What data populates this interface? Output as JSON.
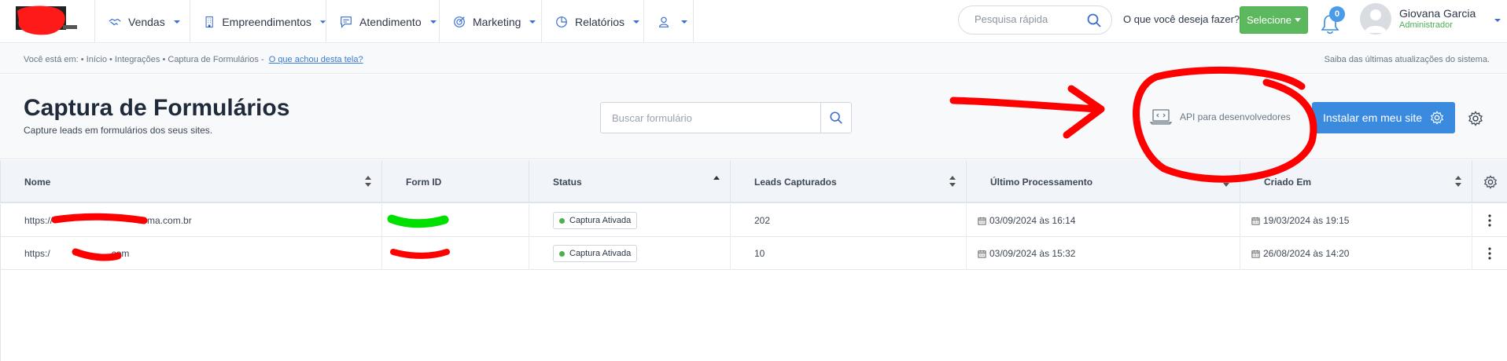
{
  "nav": {
    "items": [
      {
        "label": "Vendas",
        "icon": "handshake-icon"
      },
      {
        "label": "Empreendimentos",
        "icon": "building-icon"
      },
      {
        "label": "Atendimento",
        "icon": "chat-icon"
      },
      {
        "label": "Marketing",
        "icon": "target-icon"
      },
      {
        "label": "Relatórios",
        "icon": "pie-chart-icon"
      },
      {
        "label": "",
        "icon": "user-icon"
      }
    ],
    "search_placeholder": "Pesquisa rápida",
    "ask_label": "O que você deseja fazer?",
    "select_label": "Selecione",
    "notification_count": "0",
    "user": {
      "name": "Giovana Garcia",
      "role": "Administrador"
    }
  },
  "breadcrumb": {
    "text": "Você está em: • Início • Integrações • Captura de Formulários -",
    "feedback_link": "O que achou desta tela?",
    "updates": "Saiba das últimas atualizações do sistema."
  },
  "header": {
    "title": "Captura de Formulários",
    "subtitle": "Capture leads em formulários dos seus sites.",
    "search_placeholder": "Buscar formulário",
    "api_label": "API para desenvolvedores",
    "install_label": "Instalar em meu site"
  },
  "table": {
    "columns": [
      "Nome",
      "Form ID",
      "Status",
      "Leads Capturados",
      "Último Processamento",
      "Criado Em"
    ],
    "rows": [
      {
        "nome": "https://",
        "nome_suffix": "ma.com.br",
        "status": "Captura Ativada",
        "leads": "202",
        "ultimo": "03/09/2024 às 16:14",
        "criado": "19/03/2024 às 19:15"
      },
      {
        "nome": "https:/",
        "nome_suffix": "com",
        "status": "Captura Ativada",
        "leads": "10",
        "ultimo": "03/09/2024 às 15:32",
        "criado": "26/08/2024 às 14:20"
      }
    ]
  },
  "colors": {
    "accent_blue": "#3a8be0",
    "select_green": "#5cb85c",
    "status_green": "#4caf50",
    "annotation_red": "#ff0000",
    "redaction_green": "#00e000"
  }
}
